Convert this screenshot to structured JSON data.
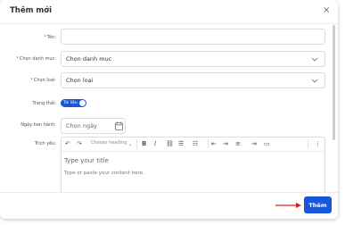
{
  "modal": {
    "title": "Thêm mới",
    "close_symbol": "×"
  },
  "form": {
    "name": {
      "required": "*",
      "label": "Tên:",
      "value": ""
    },
    "category": {
      "required": "*",
      "label": "Chọn danh mục:",
      "selected": "Chọn danh mục"
    },
    "type": {
      "required": "*",
      "label": "Chọn loại:",
      "selected": "Chọn loại"
    },
    "status": {
      "label": "Trạng thái:",
      "toggle_text": "Tài liệu",
      "on": true
    },
    "publish_date": {
      "label": "Ngày ban hành:",
      "placeholder": "Chọn ngày"
    },
    "summary": {
      "label": "Trích yếu:"
    }
  },
  "editor": {
    "heading_select": "Choose heading",
    "title_placeholder": "Type your title",
    "body_placeholder": "Type or paste your content here."
  },
  "footer": {
    "submit_label": "Thêm"
  },
  "colors": {
    "primary": "#1a56db",
    "required": "#e5484d",
    "arrow": "#d92020"
  },
  "icons": [
    "close-icon",
    "chevron-down-icon",
    "calendar-icon",
    "undo-icon",
    "redo-icon",
    "bold-icon",
    "italic-icon",
    "link-icon",
    "bulleted-list-icon",
    "numbered-list-icon",
    "align-icon",
    "indent-icon",
    "image-icon",
    "more-icon",
    "arrow-right-icon"
  ]
}
